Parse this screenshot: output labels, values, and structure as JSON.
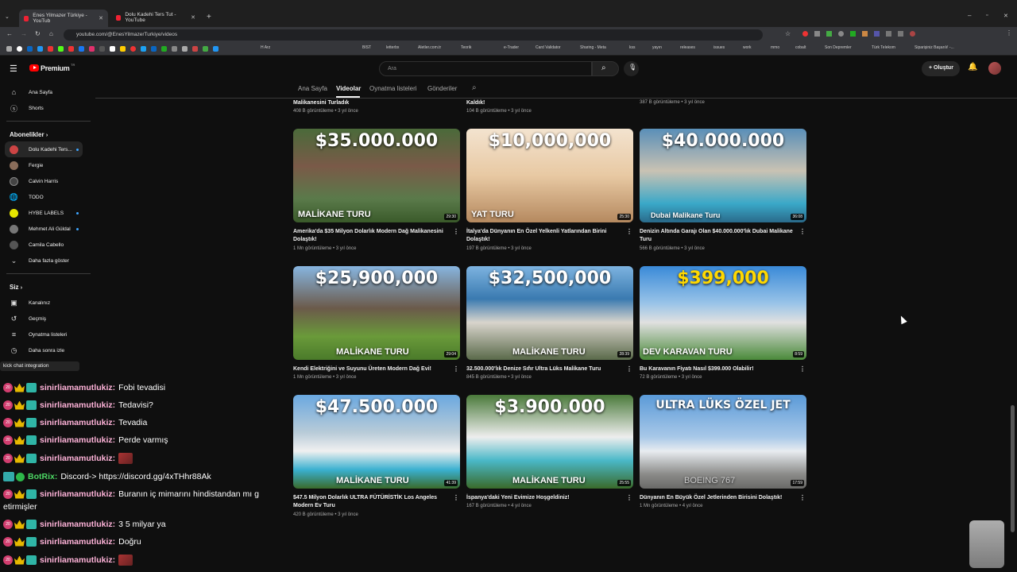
{
  "browser": {
    "tabs": [
      {
        "title": "Enes Yilmazer Türkiye - YouTub",
        "active": true
      },
      {
        "title": "Dolu Kadehi Ters Tut - YouTube",
        "active": false
      }
    ],
    "url": "youtube.com/@EnesYilmazerTurkiye/videos",
    "bookmarks": [
      "H Arz",
      "BIST",
      "letterbx",
      "Aletler.com.tr",
      "Teorik",
      "e-Trader",
      "Card Validator",
      "Sharing - Meta",
      "kss",
      "yayın",
      "releases",
      "issues",
      "work",
      "mmo",
      "cobalt",
      "Son Depremler",
      "Türk Telekom",
      "Siparişiniz Başarılı! -..."
    ]
  },
  "header": {
    "logo_text": "Premium",
    "logo_sup": "TR",
    "search_placeholder": "Ara",
    "create_label": "Oluştur"
  },
  "sidebar": {
    "main": [
      {
        "label": "Ana Sayfa",
        "icon": "home-icon"
      },
      {
        "label": "Shorts",
        "icon": "shorts-icon"
      }
    ],
    "subscriptions_title": "Abonelikler",
    "subscriptions": [
      {
        "label": "Dolu Kadehi Ters...",
        "color": "#c44",
        "dot": true,
        "active": true
      },
      {
        "label": "Fergie",
        "color": "#8a6d5a",
        "dot": false
      },
      {
        "label": "Calvin Harris",
        "color": "#444",
        "dot": false
      },
      {
        "label": "TODO",
        "color": "#333",
        "dot": false
      },
      {
        "label": "HYBE LABELS",
        "color": "#e6e600",
        "dot": true
      },
      {
        "label": "Mehmet Ali Güldal",
        "color": "#777",
        "dot": true
      },
      {
        "label": "Camila Cabello",
        "color": "#555",
        "dot": false
      },
      {
        "label": "Daha fazla göster",
        "color": "",
        "dot": false
      }
    ],
    "you_title": "Siz",
    "you": [
      {
        "label": "Kanalınız",
        "icon": "channel-icon"
      },
      {
        "label": "Geçmiş",
        "icon": "history-icon"
      },
      {
        "label": "Oynatma listeleri",
        "icon": "playlist-icon"
      },
      {
        "label": "Daha sonra izle",
        "icon": "clock-icon"
      }
    ]
  },
  "channel_tabs": [
    "Ana Sayfa",
    "Videolar",
    "Oynatma listeleri",
    "Gönderiler"
  ],
  "top_row": [
    {
      "title": "Malikanesini Turladık",
      "meta": "408 B görüntüleme • 3 yıl önce"
    },
    {
      "title": "Kaldık!",
      "meta": "104 B görüntüleme • 3 yıl önce"
    },
    {
      "title": "",
      "meta": "387 B görüntüleme • 3 yıl önce"
    }
  ],
  "videos": [
    {
      "price": "$35.000.000",
      "caption": "MALİKANE TURU",
      "duration": "29:30",
      "title": "Amerika'da $35 Milyon Dolarlık Modern Dağ Malikanesini Dolaştık!",
      "meta": "1 Mn görüntüleme • 3 yıl önce"
    },
    {
      "price": "$10,000,000",
      "caption": "YAT TURU",
      "duration": "25:30",
      "title": "İtalya'da Dünyanın En Özel Yelkenli Yatlarından Birini Dolaştık!",
      "meta": "197 B görüntüleme • 3 yıl önce"
    },
    {
      "price": "$40.000.000",
      "caption": "Dubai Malikane Turu",
      "duration": "36:08",
      "title": "Denizin Altında Garajı Olan $40.000.000'lık Dubai Malikane Turu",
      "meta": "566 B görüntüleme • 3 yıl önce"
    },
    {
      "price": "$25,900,000",
      "caption": "MALİKANE TURU",
      "duration": "29:04",
      "title": "Kendi Elektriğini ve Suyunu Üreten Modern Dağ Evi!",
      "meta": "1 Mn görüntüleme • 3 yıl önce"
    },
    {
      "price": "$32,500,000",
      "caption": "MALİKANE TURU",
      "duration": "28:39",
      "title": "32.500.000'lık Denize Sıfır Ultra Lüks Malikane Turu",
      "meta": "845 B görüntüleme • 3 yıl önce"
    },
    {
      "price": "$399,000",
      "caption": "DEV KARAVAN TURU",
      "duration": "8:59",
      "title": "Bu Karavanın Fiyatı Nasıl $399.000 Olabilir!",
      "meta": "72 B görüntüleme • 3 yıl önce"
    },
    {
      "price": "$47.500.000",
      "caption": "MALİKANE TURU",
      "duration": "41:39",
      "title": "$47.5 Milyon Dolarlık ULTRA FÜTÜRİSTİK Los Angeles Modern Ev Turu",
      "meta": "420 B görüntüleme • 3 yıl önce"
    },
    {
      "price": "$3.900.000",
      "caption": "MALİKANE TURU",
      "duration": "25:55",
      "title": "İspanya'daki Yeni Evimize Hoşgeldiniz!",
      "meta": "167 B görüntüleme • 4 yıl önce"
    },
    {
      "price": "ULTRA LÜKS ÖZEL JET",
      "caption": "BOEING 767",
      "duration": "17:59",
      "title": "Dünyanın En Büyük Özel Jetlerinden Birisini Dolaştık!",
      "meta": "1 Mn görüntüleme • 4 yıl önce"
    }
  ],
  "chat": {
    "banner": "kick chat integration",
    "messages": [
      {
        "user": "sinirliamamutlukiz:",
        "text": "Fobi tevadisi",
        "emote": false
      },
      {
        "user": "sinirliamamutlukiz:",
        "text": "Tedavisi?",
        "emote": false
      },
      {
        "user": "sinirliamamutlukiz:",
        "text": "Tevadia",
        "emote": false
      },
      {
        "user": "sinirliamamutlukiz:",
        "text": "Perde varmış",
        "emote": false
      },
      {
        "user": "sinirliamamutlukiz:",
        "text": "",
        "emote": true
      },
      {
        "user": "BotRix:",
        "text": "Discord-> https://discord.gg/4xTHhr88Ak",
        "emote": false,
        "bot": true
      },
      {
        "user": "sinirliamamutlukiz:",
        "text": "Buranın iç mimarını hindistandan mı g",
        "emote": false
      },
      {
        "user": "",
        "text": "etirmişler",
        "emote": false,
        "cont": true
      },
      {
        "user": "sinirliamamutlukiz:",
        "text": "3 5 milyar ya",
        "emote": false
      },
      {
        "user": "sinirliamamutlukiz:",
        "text": "Doğru",
        "emote": false
      },
      {
        "user": "sinirliamamutlukiz:",
        "text": "",
        "emote": true
      }
    ]
  }
}
